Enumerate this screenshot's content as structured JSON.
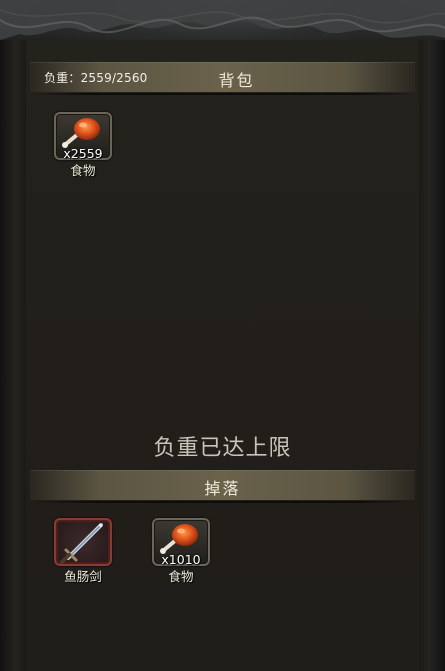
{
  "bag": {
    "weight_label": "负重：2559/2560",
    "title": "背包",
    "items": [
      {
        "icon": "chicken-leg-icon",
        "quantity": "x2559",
        "name": "食物"
      }
    ]
  },
  "limit_message": "负重已达上限",
  "drop": {
    "title": "掉落",
    "items": [
      {
        "icon": "sword-icon",
        "quantity": "",
        "name": "鱼肠剑"
      },
      {
        "icon": "chicken-leg-icon",
        "quantity": "x1010",
        "name": "食物"
      }
    ]
  },
  "colors": {
    "background": "#1b1a16",
    "bar_center": "#6a624b",
    "text": "#efe9da",
    "sword_frame": "#8a3a33"
  }
}
